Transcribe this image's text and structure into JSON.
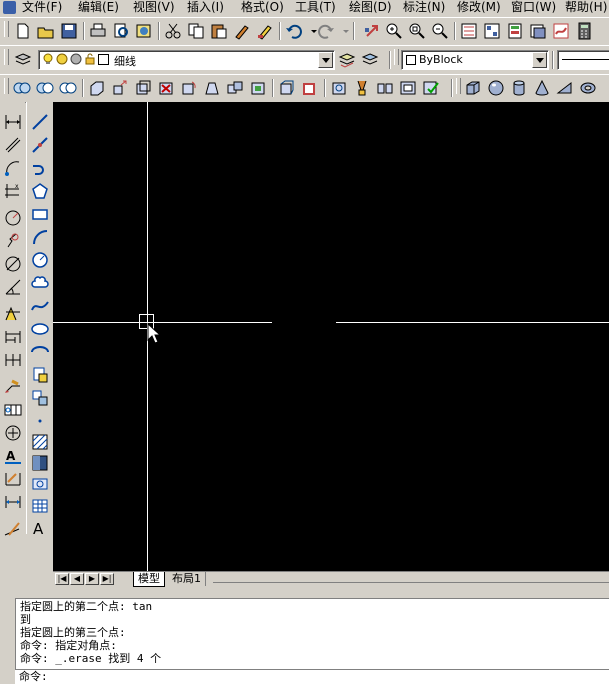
{
  "menubar": {
    "items": [
      {
        "label": "文件(F)"
      },
      {
        "label": "编辑(E)"
      },
      {
        "label": "视图(V)"
      },
      {
        "label": "插入(I)"
      },
      {
        "label": "格式(O)"
      },
      {
        "label": "工具(T)"
      },
      {
        "label": "绘图(D)"
      },
      {
        "label": "标注(N)"
      },
      {
        "label": "修改(M)"
      },
      {
        "label": "窗口(W)"
      },
      {
        "label": "帮助(H)"
      }
    ]
  },
  "layer_toolbar": {
    "layer_name": "细线",
    "color_value": "ByBlock"
  },
  "tabs": [
    {
      "label": "模型"
    },
    {
      "label": "布局1"
    }
  ],
  "command_window": {
    "lines": [
      "指定圆上的第二个点: tan",
      "到",
      "指定圆上的第三个点:",
      "命令: 指定对角点:",
      "命令: _.erase 找到 4 个"
    ],
    "prompt": "命令:"
  },
  "colors": {
    "canvas": "#000000",
    "crosshair": "#ffffff",
    "chrome": "#d4d0c8"
  }
}
